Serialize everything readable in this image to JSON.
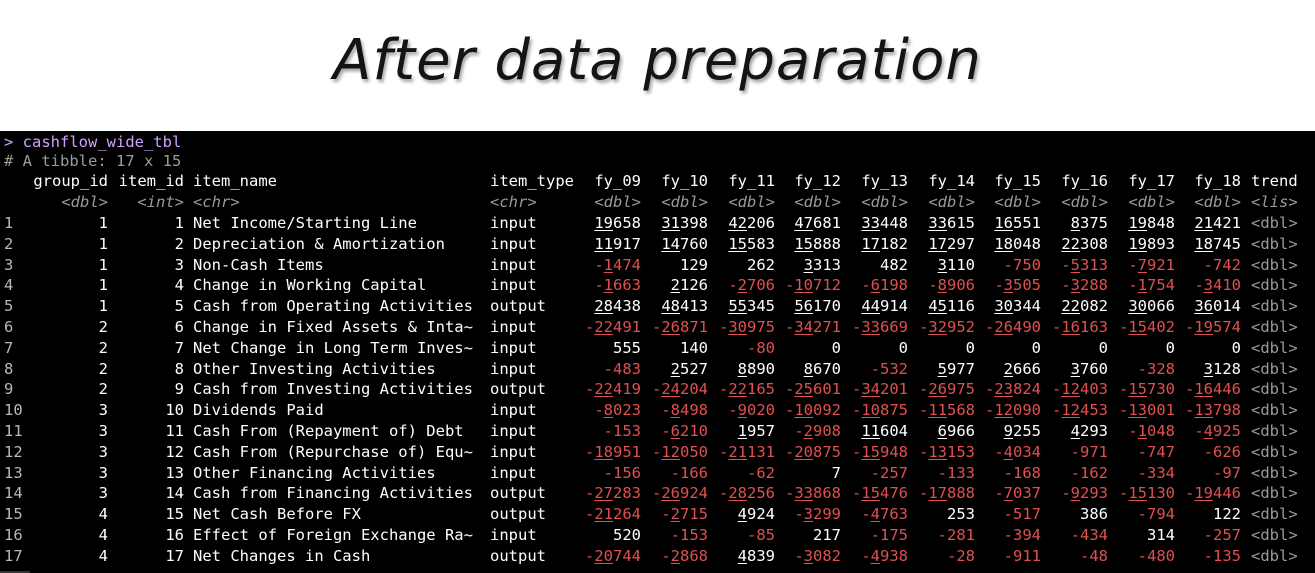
{
  "title": "After data preparation",
  "console": {
    "prompt": "> cashflow_wide_tbl",
    "tibble_info": "# A tibble: 17 x 15",
    "columns": [
      "group_id",
      "item_id",
      "item_name",
      "item_type",
      "fy_09",
      "fy_10",
      "fy_11",
      "fy_12",
      "fy_13",
      "fy_14",
      "fy_15",
      "fy_16",
      "fy_17",
      "fy_18",
      "trend"
    ],
    "types": [
      "<dbl>",
      "<int>",
      "<chr>",
      "<chr>",
      "<dbl>",
      "<dbl>",
      "<dbl>",
      "<dbl>",
      "<dbl>",
      "<dbl>",
      "<dbl>",
      "<dbl>",
      "<dbl>",
      "<dbl>",
      "<lis>"
    ],
    "rows": [
      [
        "1",
        "1",
        "1",
        "Net Income/Starting Line",
        "input",
        "19658",
        "31398",
        "42206",
        "47681",
        "33448",
        "33615",
        "16551",
        "8375",
        "19848",
        "21421",
        "<dbl>"
      ],
      [
        "2",
        "1",
        "2",
        "Depreciation & Amortization",
        "input",
        "11917",
        "14760",
        "15583",
        "15888",
        "17182",
        "17297",
        "18048",
        "22308",
        "19893",
        "18745",
        "<dbl>"
      ],
      [
        "3",
        "1",
        "3",
        "Non-Cash Items",
        "input",
        "-1474",
        "129",
        "262",
        "3313",
        "482",
        "3110",
        "-750",
        "-5313",
        "-7921",
        "-742",
        "<dbl>"
      ],
      [
        "4",
        "1",
        "4",
        "Change in Working Capital",
        "input",
        "-1663",
        "2126",
        "-2706",
        "-10712",
        "-6198",
        "-8906",
        "-3505",
        "-3288",
        "-1754",
        "-3410",
        "<dbl>"
      ],
      [
        "5",
        "1",
        "5",
        "Cash from Operating Activities",
        "output",
        "28438",
        "48413",
        "55345",
        "56170",
        "44914",
        "45116",
        "30344",
        "22082",
        "30066",
        "36014",
        "<dbl>"
      ],
      [
        "6",
        "2",
        "6",
        "Change in Fixed Assets & Inta~",
        "input",
        "-22491",
        "-26871",
        "-30975",
        "-34271",
        "-33669",
        "-32952",
        "-26490",
        "-16163",
        "-15402",
        "-19574",
        "<dbl>"
      ],
      [
        "7",
        "2",
        "7",
        "Net Change in Long Term Inves~",
        "input",
        "555",
        "140",
        "-80",
        "0",
        "0",
        "0",
        "0",
        "0",
        "0",
        "0",
        "<dbl>"
      ],
      [
        "8",
        "2",
        "8",
        "Other Investing Activities",
        "input",
        "-483",
        "2527",
        "8890",
        "8670",
        "-532",
        "5977",
        "2666",
        "3760",
        "-328",
        "3128",
        "<dbl>"
      ],
      [
        "9",
        "2",
        "9",
        "Cash from Investing Activities",
        "output",
        "-22419",
        "-24204",
        "-22165",
        "-25601",
        "-34201",
        "-26975",
        "-23824",
        "-12403",
        "-15730",
        "-16446",
        "<dbl>"
      ],
      [
        "10",
        "3",
        "10",
        "Dividends Paid",
        "input",
        "-8023",
        "-8498",
        "-9020",
        "-10092",
        "-10875",
        "-11568",
        "-12090",
        "-12453",
        "-13001",
        "-13798",
        "<dbl>"
      ],
      [
        "11",
        "3",
        "11",
        "Cash From (Repayment of) Debt",
        "input",
        "-153",
        "-6210",
        "1957",
        "-2908",
        "11604",
        "6966",
        "9255",
        "4293",
        "-1048",
        "-4925",
        "<dbl>"
      ],
      [
        "12",
        "3",
        "12",
        "Cash From (Repurchase of) Equ~",
        "input",
        "-18951",
        "-12050",
        "-21131",
        "-20875",
        "-15948",
        "-13153",
        "-4034",
        "-971",
        "-747",
        "-626",
        "<dbl>"
      ],
      [
        "13",
        "3",
        "13",
        "Other Financing Activities",
        "input",
        "-156",
        "-166",
        "-62",
        "7",
        "-257",
        "-133",
        "-168",
        "-162",
        "-334",
        "-97",
        "<dbl>"
      ],
      [
        "14",
        "3",
        "14",
        "Cash from Financing Activities",
        "output",
        "-27283",
        "-26924",
        "-28256",
        "-33868",
        "-15476",
        "-17888",
        "-7037",
        "-9293",
        "-15130",
        "-19446",
        "<dbl>"
      ],
      [
        "15",
        "4",
        "15",
        "Net Cash Before FX",
        "output",
        "-21264",
        "-2715",
        "4924",
        "-3299",
        "-4763",
        "253",
        "-517",
        "386",
        "-794",
        "122",
        "<dbl>"
      ],
      [
        "16",
        "4",
        "16",
        "Effect of Foreign Exchange Ra~",
        "input",
        "520",
        "-153",
        "-85",
        "217",
        "-175",
        "-281",
        "-394",
        "-434",
        "314",
        "-257",
        "<dbl>"
      ],
      [
        "17",
        "4",
        "17",
        "Net Changes in Cash",
        "output",
        "-20744",
        "-2868",
        "4839",
        "-3082",
        "-4938",
        "-28",
        "-911",
        "-48",
        "-480",
        "-135",
        "<dbl>"
      ]
    ]
  },
  "colors": {
    "console_bg": "#000000",
    "prompt": "#d0a0ff",
    "negative": "#e05050",
    "muted": "#9a9a9a",
    "text": "#ffffff"
  }
}
